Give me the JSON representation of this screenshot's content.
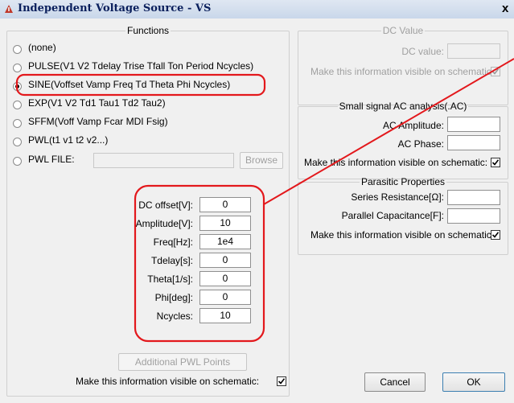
{
  "window": {
    "title": "Independent Voltage Source - VS",
    "close_glyph": "x"
  },
  "functions": {
    "legend": "Functions",
    "options": [
      {
        "label": "(none)",
        "selected": false
      },
      {
        "label": "PULSE(V1 V2 Tdelay Trise Tfall Ton Period Ncycles)",
        "selected": false
      },
      {
        "label": "SINE(Voffset Vamp Freq Td Theta Phi Ncycles)",
        "selected": true
      },
      {
        "label": "EXP(V1 V2 Td1 Tau1 Td2 Tau2)",
        "selected": false
      },
      {
        "label": "SFFM(Voff Vamp Fcar MDI Fsig)",
        "selected": false
      },
      {
        "label": "PWL(t1 v1 t2 v2...)",
        "selected": false
      },
      {
        "label": "PWL FILE:",
        "selected": false
      }
    ],
    "pwl_file_value": "",
    "browse_label": "Browse",
    "params": [
      {
        "label": "DC offset[V]:",
        "value": "0"
      },
      {
        "label": "Amplitude[V]:",
        "value": "10"
      },
      {
        "label": "Freq[Hz]:",
        "value": "1e4"
      },
      {
        "label": "Tdelay[s]:",
        "value": "0"
      },
      {
        "label": "Theta[1/s]:",
        "value": "0"
      },
      {
        "label": "Phi[deg]:",
        "value": "0"
      },
      {
        "label": "Ncycles:",
        "value": "10"
      }
    ],
    "additional_pwl_label": "Additional PWL Points",
    "visible_label": "Make this information visible on schematic:",
    "visible_checked": true
  },
  "dc_value": {
    "legend": "DC Value",
    "field_label": "DC value:",
    "value": "",
    "visible_label": "Make this information visible on schematic:",
    "visible_checked": true
  },
  "ac": {
    "legend": "Small signal AC analysis(.AC)",
    "amplitude_label": "AC Amplitude:",
    "amplitude_value": "",
    "phase_label": "AC Phase:",
    "phase_value": "",
    "visible_label": "Make this information visible on schematic:",
    "visible_checked": true
  },
  "parasitic": {
    "legend": "Parasitic Properties",
    "series_label": "Series Resistance[Ω]:",
    "series_value": "",
    "parallel_label": "Parallel Capacitance[F]:",
    "parallel_value": "",
    "visible_label": "Make this information visible on schematic:",
    "visible_checked": true
  },
  "buttons": {
    "cancel": "Cancel",
    "ok": "OK"
  },
  "annotation": {
    "color": "#e3181c"
  }
}
